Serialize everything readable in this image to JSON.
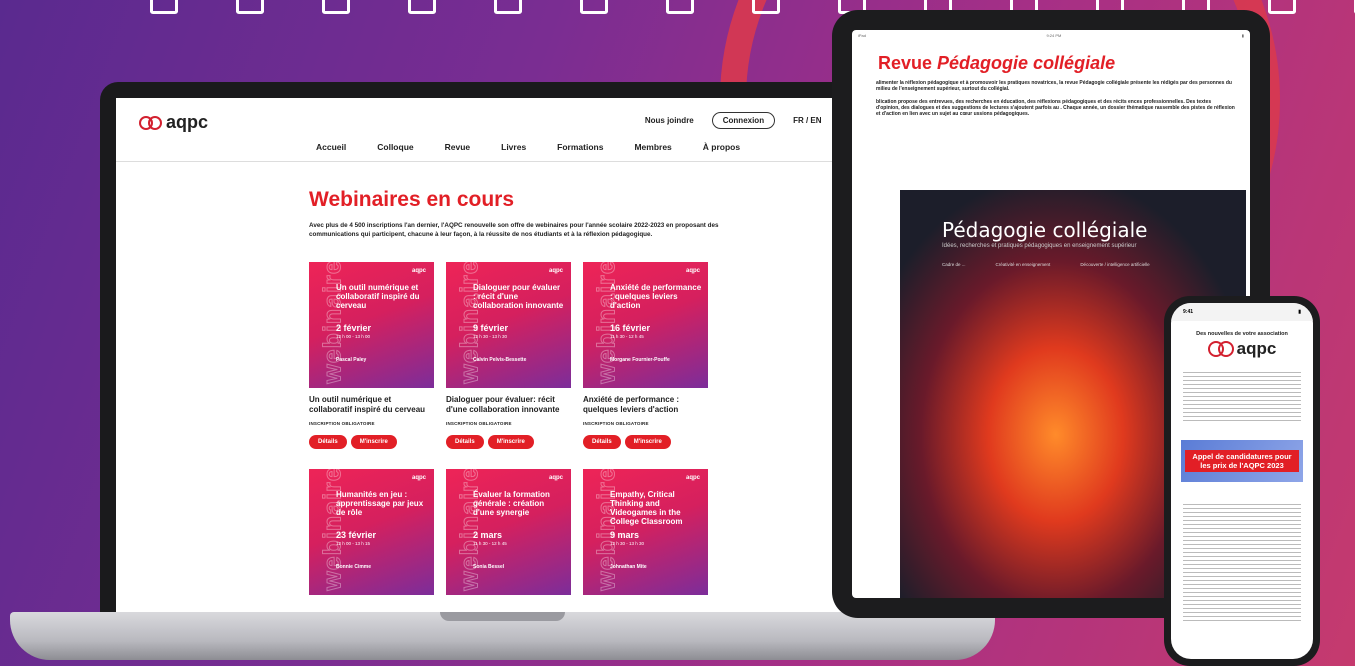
{
  "site": {
    "logo_text": "aqpc",
    "util": {
      "join": "Nous joindre",
      "login": "Connexion",
      "lang": "FR / EN",
      "cart_icon": "cart-icon"
    },
    "nav": [
      "Accueil",
      "Colloque",
      "Revue",
      "Livres",
      "Formations",
      "Membres",
      "À propos"
    ]
  },
  "webinars": {
    "title": "Webinaires en cours",
    "intro": "Avec plus de 4 500 inscriptions l'an dernier, l'AQPC renouvelle son offre de webinaires pour l'année scolaire 2022-2023 en proposant des communications qui participent, chacune à leur façon, à la réussite de nos étudiants et à la réflexion pédagogique.",
    "card_vertical": "webinaire",
    "card_brand": "aqpc",
    "required": "INSCRIPTION OBLIGATOIRE",
    "btn_details": "Détails",
    "btn_register": "M'inscrire",
    "cards": [
      {
        "img_title": "Un outil numérique et collaboratif inspiré du cerveau",
        "date": "2 février",
        "hours": "12 h 00 - 13 h 00",
        "presenter": "Pascal Paley",
        "title": "Un outil numérique et collaboratif inspiré du cerveau"
      },
      {
        "img_title": "Dialoguer pour évaluer : récit d'une collaboration innovante",
        "date": "9 février",
        "hours": "12 h 30 - 13 h 30",
        "presenter": "Calvin Pelvis-Bessette",
        "title": "Dialoguer pour évaluer: récit d'une collaboration innovante"
      },
      {
        "img_title": "Anxiété de performance : quelques leviers d'action",
        "date": "16 février",
        "hours": "11 h 30 - 12 h 45",
        "presenter": "Morgane Fournier-Pouffe",
        "title": "Anxiété de performance : quelques leviers d'action"
      },
      {
        "img_title": "Humanités en jeu : apprentissage par jeux de rôle",
        "date": "23 février",
        "hours": "12 h 00 - 13 h 15",
        "presenter": "Bonnie Cimme",
        "title": ""
      },
      {
        "img_title": "Évaluer la formation générale : création d'une synergie",
        "date": "2 mars",
        "hours": "11 h 30 - 12 h 45",
        "presenter": "Sonia Bessel",
        "title": ""
      },
      {
        "img_title": "Empathy, Critical Thinking and Videogames in the College Classroom",
        "date": "9 mars",
        "hours": "12 h 30 - 13 h 30",
        "presenter": "Johnathan Mite",
        "title": ""
      }
    ]
  },
  "tablet": {
    "status_left": "iPad",
    "status_center": "9:24 PM",
    "title_plain": "Revue ",
    "title_italic": "Pédagogie collégiale",
    "para1": "alimenter la réflexion pédagogique et à promouvoir les pratiques novatrices, la revue Pédagogie collégiale présente les rédigés par des personnes du milieu de l'enseignement supérieur, surtout du collégial.",
    "para2": "blication propose des entrevues, des recherches en éducation, des réflexions pédagogiques et des récits ences professionnelles. Des textes d'opinion, des dialogues et des suggestions de lectures s'ajoutent parfois au . Chaque année, un dossier thématique rassemble des pistes de réflexion et d'action en lien avec un sujet au cœur ussions pédagogiques.",
    "cover_title": "Pédagogie collégiale",
    "cover_sub": "Idées, recherches et pratiques pédagogiques en enseignement supérieur",
    "cover_cols": [
      "Cadre de ...",
      "Créativité en enseignement",
      "Découverte / intelligence artificielle"
    ]
  },
  "phone": {
    "time": "9:41",
    "header": "Des nouvelles de votre association",
    "logo_text": "aqpc",
    "banner": "Appel de candidatures pour les prix de l'AQPC 2023"
  }
}
